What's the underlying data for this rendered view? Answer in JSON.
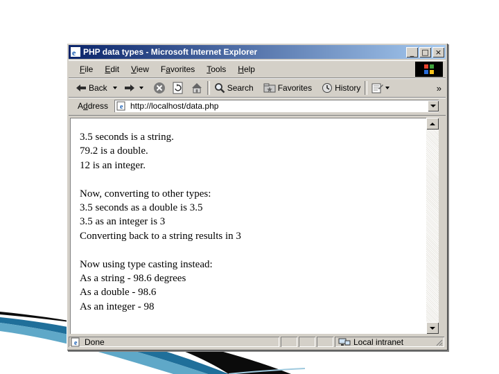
{
  "window": {
    "title": "PHP data types - Microsoft Internet Explorer"
  },
  "window_controls": {
    "minimize": "_",
    "maximize": "□",
    "close": "×"
  },
  "menu": [
    {
      "pre": "",
      "ul": "F",
      "post": "ile"
    },
    {
      "pre": "",
      "ul": "E",
      "post": "dit"
    },
    {
      "pre": "",
      "ul": "V",
      "post": "iew"
    },
    {
      "pre": "F",
      "ul": "a",
      "post": "vorites"
    },
    {
      "pre": "",
      "ul": "T",
      "post": "ools"
    },
    {
      "pre": "",
      "ul": "H",
      "post": "elp"
    }
  ],
  "toolbar": {
    "back": "Back",
    "search": "Search",
    "favorites": "Favorites",
    "history": "History",
    "more": "»"
  },
  "address": {
    "label_pre": "A",
    "label_ul": "d",
    "label_post": "dress",
    "url": "http://localhost/data.php"
  },
  "content": {
    "lines": [
      "3.5 seconds is a string.",
      "79.2 is a double.",
      "12 is an integer.",
      "",
      "Now, converting to other types:",
      "3.5 seconds as a double is 3.5",
      "3.5 as an integer is 3",
      "Converting back to a string results in 3",
      "",
      "Now using type casting instead:",
      "As a string - 98.6 degrees",
      "As a double - 98.6",
      "As an integer - 98"
    ]
  },
  "status": {
    "text": "Done",
    "zone": "Local intranet"
  },
  "colors": {
    "titlebar_start": "#0a246a",
    "titlebar_end": "#a6caf0",
    "chrome": "#d4d0c8"
  }
}
